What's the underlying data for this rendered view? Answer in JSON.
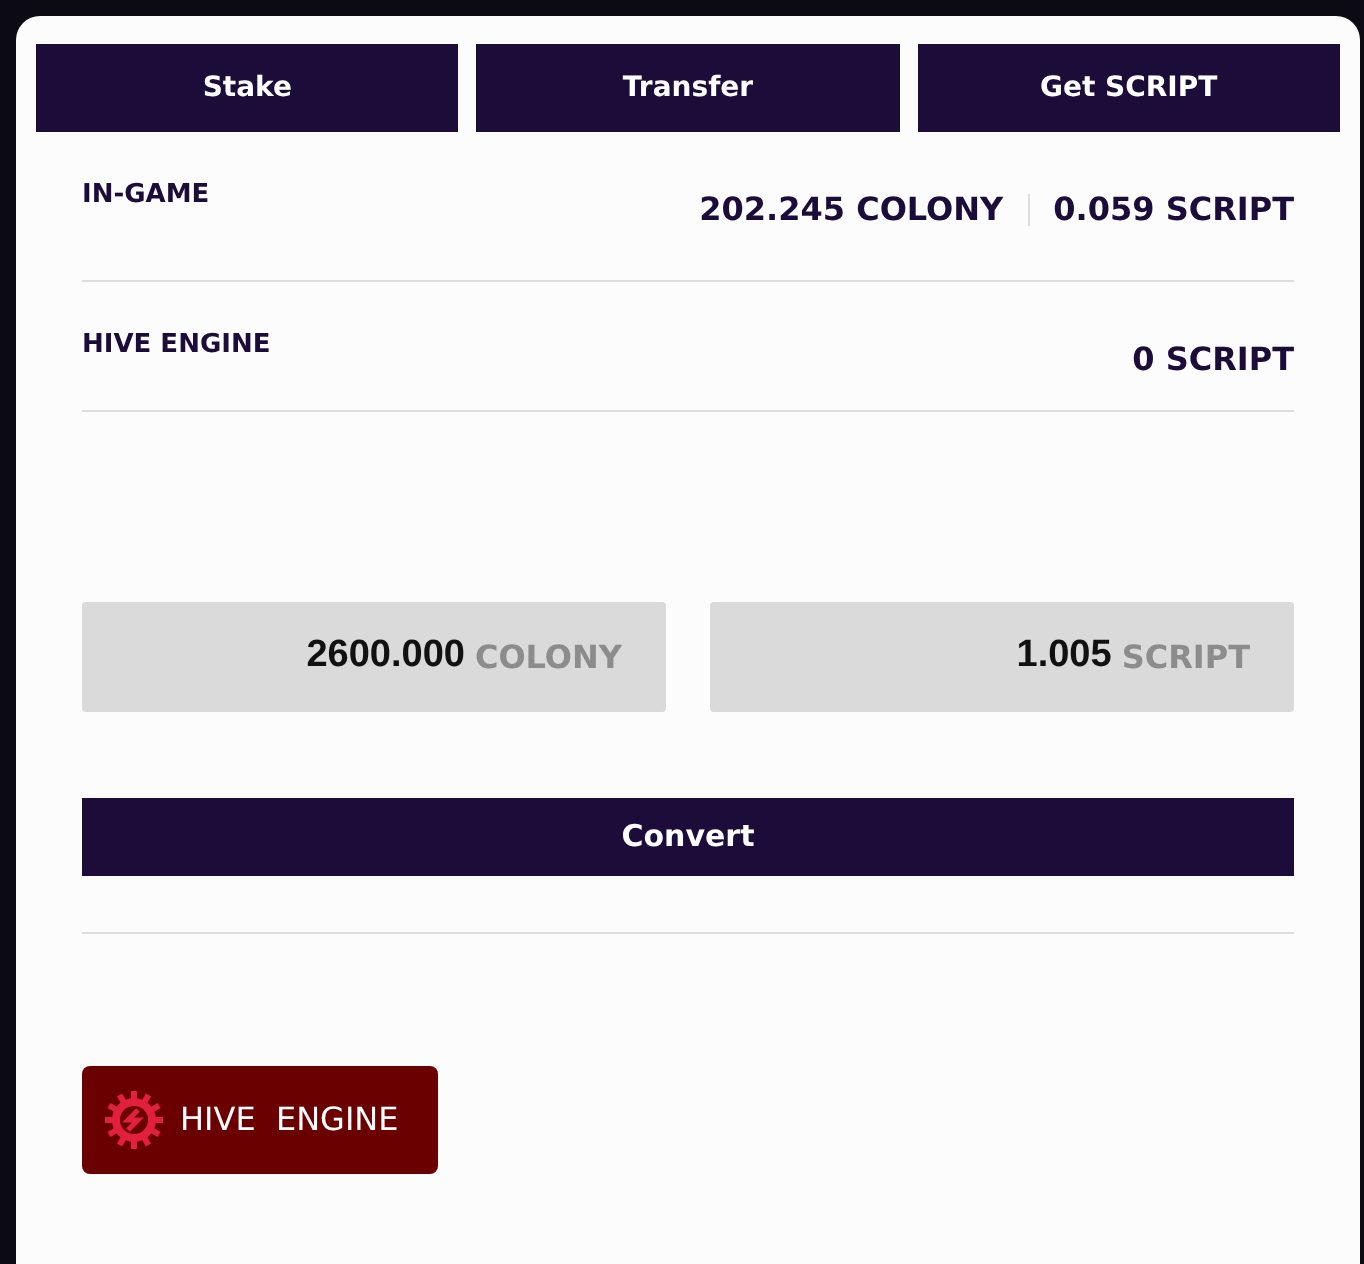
{
  "tabs": [
    {
      "label": "Stake"
    },
    {
      "label": "Transfer"
    },
    {
      "label": "Get SCRIPT"
    }
  ],
  "balances": [
    {
      "label": "IN-GAME",
      "values": [
        "202.245 COLONY",
        "0.059 SCRIPT"
      ]
    },
    {
      "label": "HIVE ENGINE",
      "values": [
        "0 SCRIPT"
      ]
    }
  ],
  "converter": {
    "fields": [
      {
        "value": "2600.000",
        "unit": "COLONY"
      },
      {
        "value": "1.005",
        "unit": "SCRIPT"
      }
    ],
    "button": "Convert"
  },
  "hive_engine_link": {
    "label": "HIVE  ENGINE"
  }
}
